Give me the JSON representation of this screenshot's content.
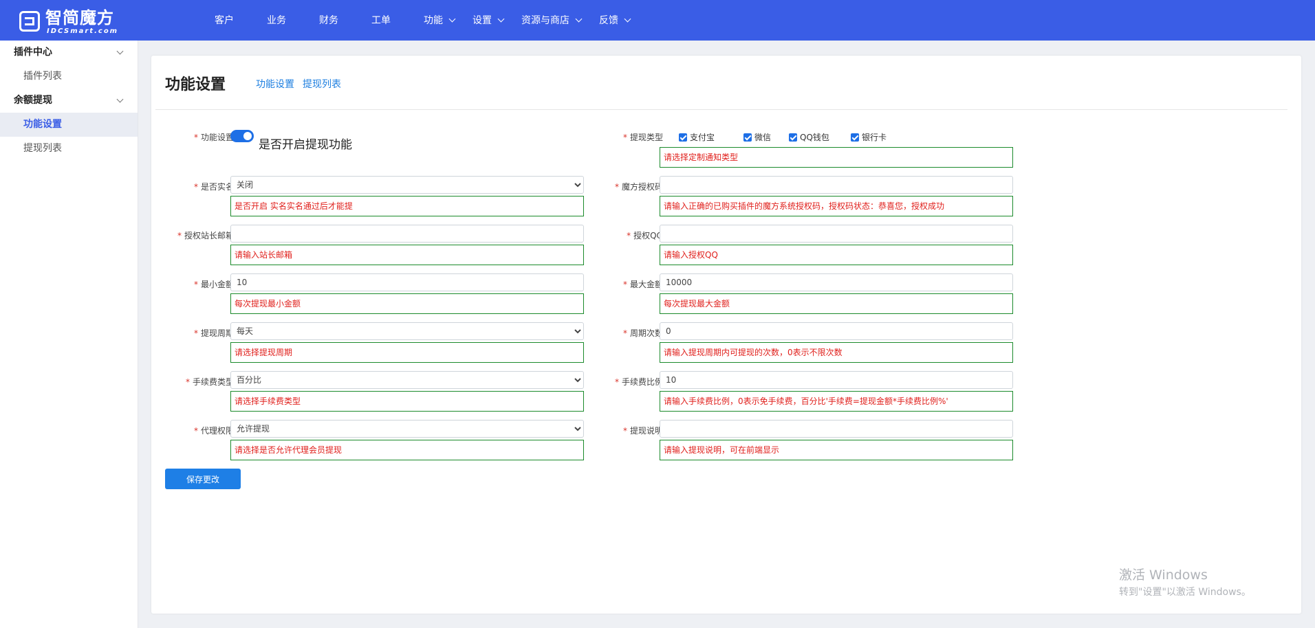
{
  "brand": {
    "name": "智简魔方",
    "sub": "IDCSmart.com"
  },
  "nav": {
    "items": [
      {
        "label": "客户",
        "dropdown": false
      },
      {
        "label": "业务",
        "dropdown": false
      },
      {
        "label": "财务",
        "dropdown": false
      },
      {
        "label": "工单",
        "dropdown": false
      },
      {
        "label": "功能",
        "dropdown": true
      },
      {
        "label": "设置",
        "dropdown": true
      },
      {
        "label": "资源与商店",
        "dropdown": true
      },
      {
        "label": "反馈",
        "dropdown": true
      }
    ]
  },
  "sidebar": {
    "group1": "插件中心",
    "group1_items": [
      "插件列表"
    ],
    "group2": "余额提现",
    "group2_items": [
      "功能设置",
      "提现列表"
    ]
  },
  "page": {
    "title": "功能设置",
    "tabs": [
      "功能设置",
      "提现列表"
    ]
  },
  "form": {
    "enable": {
      "label": "功能设置",
      "text": "是否开启提现功能",
      "on": true
    },
    "withdraw_type": {
      "label": "提现类型",
      "options": [
        "支付宝",
        "微信",
        "QQ钱包",
        "银行卡"
      ],
      "hint": "请选择定制通知类型"
    },
    "real_name": {
      "label": "是否实名",
      "value": "关闭",
      "hint": "是否开启 实名实名通过后才能提"
    },
    "auth_code": {
      "label": "魔方授权码",
      "value": "",
      "hint": "请输入正确的已购买插件的魔方系统授权码，授权码状态：恭喜您，授权成功"
    },
    "email": {
      "label": "授权站长邮箱",
      "value": "",
      "hint": "请输入站长邮箱"
    },
    "qq": {
      "label": "授权QQ",
      "value": "",
      "hint": "请输入授权QQ"
    },
    "min_amount": {
      "label": "最小金额",
      "value": "10",
      "hint": "每次提现最小金额"
    },
    "max_amount": {
      "label": "最大金额",
      "value": "10000",
      "hint": "每次提现最大金额"
    },
    "period": {
      "label": "提现周期",
      "value": "每天",
      "hint": "请选择提现周期"
    },
    "period_count": {
      "label": "周期次数",
      "value": "0",
      "hint": "请输入提现周期内可提现的次数，0表示不限次数"
    },
    "fee_type": {
      "label": "手续费类型",
      "value": "百分比",
      "hint": "请选择手续费类型"
    },
    "fee_ratio": {
      "label": "手续费比例",
      "value": "10",
      "hint": "请输入手续费比例，0表示免手续费，百分比'手续费=提现金额*手续费比例%'"
    },
    "agent": {
      "label": "代理权限",
      "value": "允许提现",
      "hint": "请选择是否允许代理会员提现"
    },
    "note": {
      "label": "提现说明",
      "value": "",
      "hint": "请输入提现说明，可在前端显示"
    },
    "save_label": "保存更改"
  },
  "watermark": {
    "line1": "激活 Windows",
    "line2": "转到\"设置\"以激活 Windows。"
  },
  "colors": {
    "topbar": "#3a5de6",
    "link": "#1e7fe0",
    "hint_border": "#1a8a2a",
    "hint_text": "#e0201c",
    "button": "#1e7fe6"
  }
}
